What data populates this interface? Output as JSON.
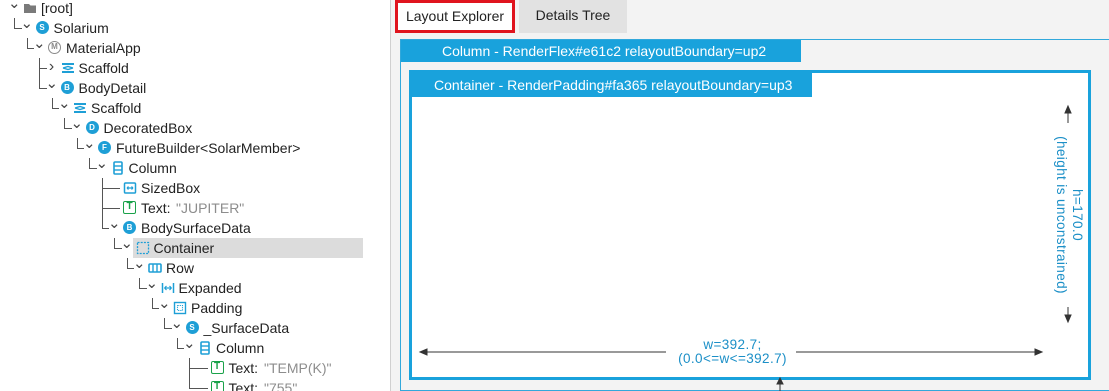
{
  "tree": {
    "items": [
      {
        "label": "[root]",
        "icon": "folder-icon",
        "depth": 0,
        "chevron": "down"
      },
      {
        "label": "Solarium",
        "icon": "stateless-widget-icon",
        "badge": "S",
        "depth": 1,
        "chevron": "down"
      },
      {
        "label": "MaterialApp",
        "icon": "material-app-icon",
        "badge": "M",
        "depth": 2,
        "chevron": "down"
      },
      {
        "label": "Scaffold",
        "icon": "scaffold-icon",
        "depth": 3,
        "chevron": "right"
      },
      {
        "label": "BodyDetail",
        "icon": "stateful-widget-icon",
        "badge": "B",
        "depth": 3,
        "chevron": "down"
      },
      {
        "label": "Scaffold",
        "icon": "scaffold-icon",
        "depth": 4,
        "chevron": "down"
      },
      {
        "label": "DecoratedBox",
        "icon": "decorated-box-icon",
        "badge": "D",
        "depth": 5,
        "chevron": "down"
      },
      {
        "label": "FutureBuilder<SolarMember>",
        "icon": "future-builder-icon",
        "badge": "F",
        "depth": 6,
        "chevron": "down"
      },
      {
        "label": "Column",
        "icon": "column-icon",
        "depth": 7,
        "chevron": "down"
      },
      {
        "label": "SizedBox",
        "icon": "sized-box-icon",
        "depth": 8,
        "chevron": "none"
      },
      {
        "label": "Text:",
        "value": "\"JUPITER\"",
        "icon": "text-icon",
        "badge": "T",
        "depth": 8,
        "chevron": "none"
      },
      {
        "label": "BodySurfaceData",
        "icon": "stateful-widget-icon",
        "badge": "B",
        "depth": 8,
        "chevron": "down"
      },
      {
        "label": "Container",
        "icon": "container-icon",
        "depth": 9,
        "chevron": "down",
        "selected": true
      },
      {
        "label": "Row",
        "icon": "row-icon",
        "depth": 10,
        "chevron": "down"
      },
      {
        "label": "Expanded",
        "icon": "expanded-icon",
        "depth": 11,
        "chevron": "down"
      },
      {
        "label": "Padding",
        "icon": "padding-icon",
        "depth": 12,
        "chevron": "down"
      },
      {
        "label": "_SurfaceData",
        "icon": "stateless-widget-icon",
        "badge": "S",
        "depth": 13,
        "chevron": "down"
      },
      {
        "label": "Column",
        "icon": "column-icon",
        "depth": 14,
        "chevron": "down"
      },
      {
        "label": "Text:",
        "value": "\"TEMP(K)\"",
        "icon": "text-icon",
        "badge": "T",
        "depth": 15,
        "chevron": "none"
      },
      {
        "label": "Text:",
        "value": "\"755\"",
        "icon": "text-icon",
        "badge": "T",
        "depth": 15,
        "chevron": "none"
      }
    ]
  },
  "tabs": {
    "layout_explorer": "Layout Explorer",
    "details_tree": "Details Tree"
  },
  "layout": {
    "column_title": "Column - RenderFlex#e61c2 relayoutBoundary=up2",
    "container_title": "Container - RenderPadding#fa365 relayoutBoundary=up3",
    "width_label_line1": "w=392.7;",
    "width_label_line2": "(0.0<=w<=392.7)",
    "height_label_line1": "h=170.0",
    "height_label_line2": "(height is unconstrained)"
  },
  "colors": {
    "accent": "#19a2dc",
    "highlight_border": "#e0141e",
    "text_widget": "#1aa24a",
    "selected_row": "#dcdcdc"
  }
}
